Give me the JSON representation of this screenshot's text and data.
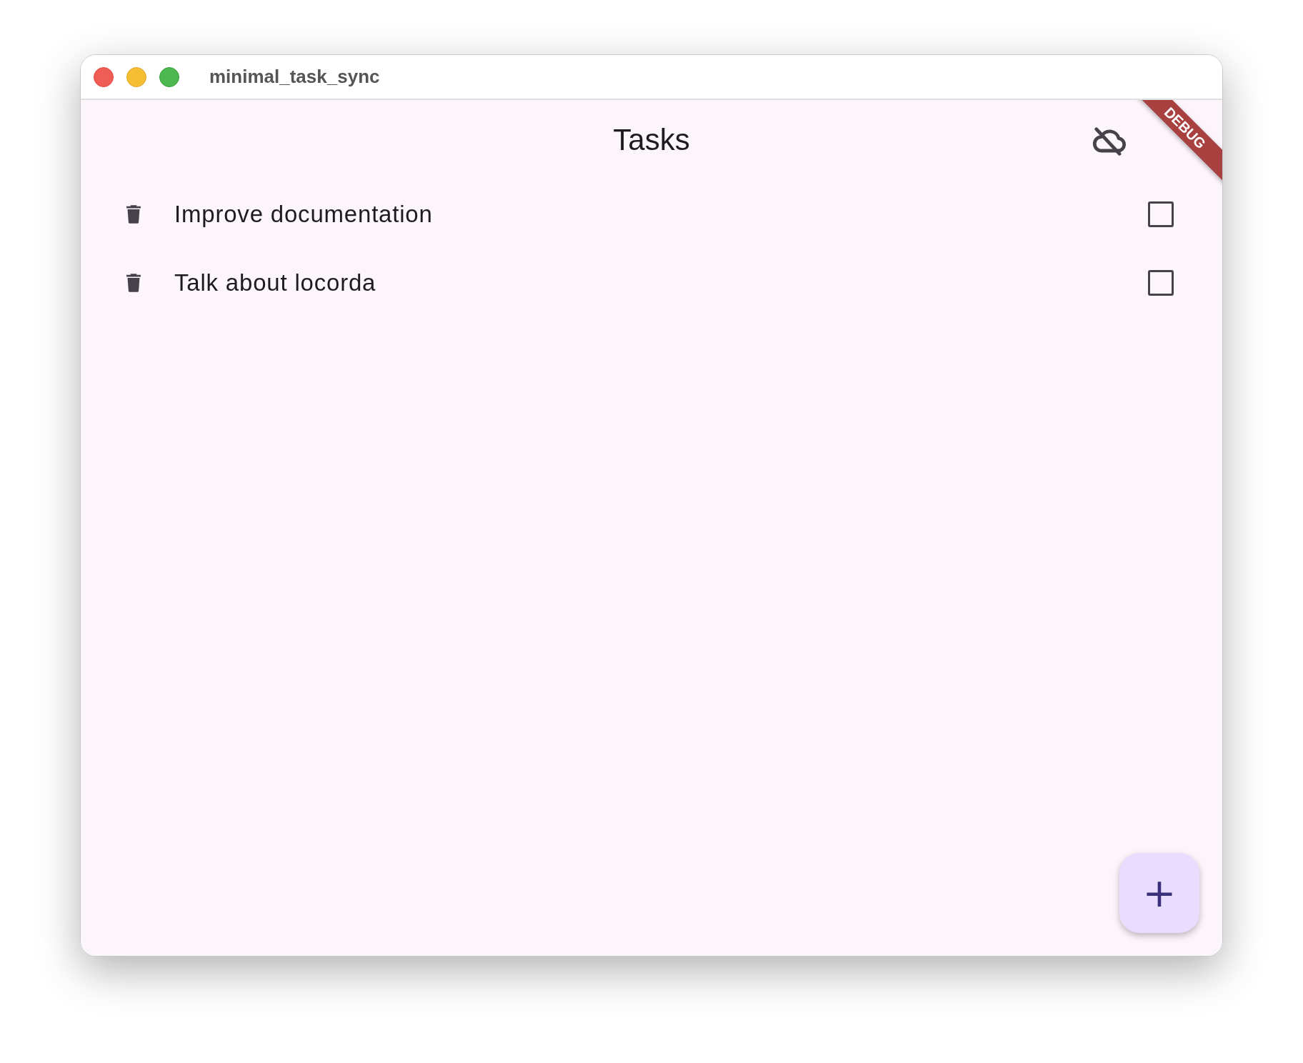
{
  "window": {
    "title": "minimal_task_sync"
  },
  "app_bar": {
    "title": "Tasks",
    "synced": false
  },
  "banner": "DEBUG",
  "tasks": [
    {
      "title": "Improve documentation",
      "checked": false
    },
    {
      "title": "Talk about locorda",
      "checked": false
    }
  ],
  "fab": {
    "label": "+"
  }
}
